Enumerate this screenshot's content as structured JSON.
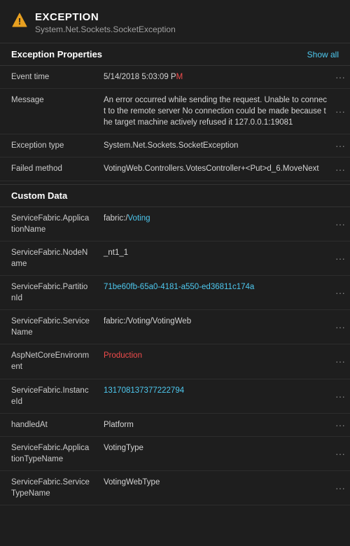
{
  "header": {
    "icon_label": "warning-triangle-icon",
    "exception_label": "EXCEPTION",
    "subtitle": "System.Net.Sockets.SocketException"
  },
  "exception_properties": {
    "section_title": "Exception Properties",
    "show_all_label": "Show all",
    "rows": [
      {
        "key": "Event time",
        "value_plain": "5/14/2018 5:03:09 P",
        "value_highlight": "M",
        "value_after": ""
      },
      {
        "key": "Message",
        "value_plain": "An error occurred while sending the request. Unable to connect to the remote server No connection could be made because the target machine actively refused it 127.0.0.1:19081",
        "value_highlight": "",
        "value_after": ""
      },
      {
        "key": "Exception type",
        "value_plain": "System.Net.Sockets.SocketException",
        "value_highlight": "",
        "value_after": ""
      },
      {
        "key": "Failed method",
        "value_plain": "VotingWeb.Controllers.VotesController+<Put>d_6.MoveNext",
        "value_highlight": "",
        "value_after": "",
        "key_highlight": true
      }
    ]
  },
  "custom_data": {
    "section_title": "Custom Data",
    "rows": [
      {
        "key": "ServiceFabric.ApplicationName",
        "value_plain": "fabric:/Voting",
        "value_link": true
      },
      {
        "key": "ServiceFabric.NodeName",
        "value_plain": "_nt1_1",
        "value_link": false
      },
      {
        "key": "ServiceFabric.PartitionId",
        "value_plain": "71be60fb-65a0-4181-a550-ed36811c174a",
        "value_link": true
      },
      {
        "key": "ServiceFabric.ServiceName",
        "value_plain": "fabric:/Voting/VotingWeb",
        "value_link": false
      },
      {
        "key": "AspNetCoreEnvironment",
        "value_plain": "Production",
        "value_highlight": true
      },
      {
        "key": "ServiceFabric.InstanceId",
        "value_plain": "131708137377222794",
        "value_link": true
      },
      {
        "key": "handledAt",
        "value_plain": "Platform",
        "value_link": false
      },
      {
        "key": "ServiceFabric.ApplicationTypeName",
        "value_plain": "VotingType",
        "value_link": false
      },
      {
        "key": "ServiceFabric.ServiceTypeName",
        "value_plain": "VotingWebType",
        "value_link": false
      }
    ]
  },
  "ellipsis": "···"
}
